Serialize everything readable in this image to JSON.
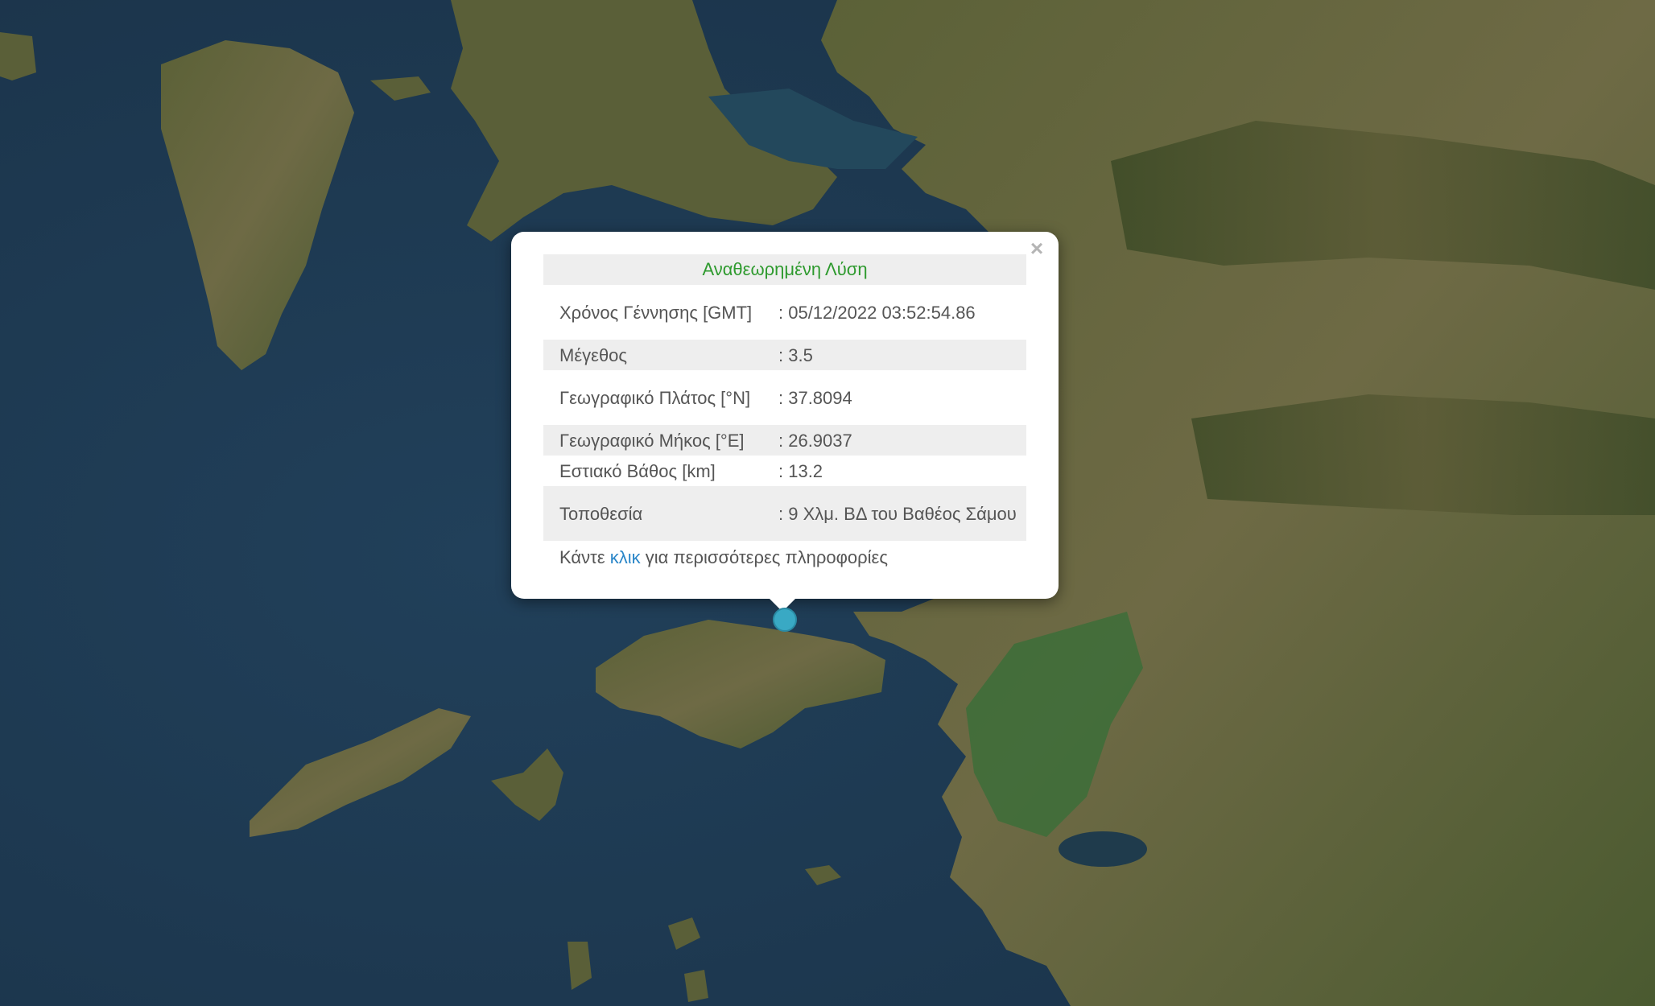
{
  "map": {
    "layer": "satellite",
    "colors": {
      "sea": "#1f3a52",
      "land": "#4f5a33",
      "land_dry": "#7a6d4f",
      "plain": "#3f6e3a"
    }
  },
  "marker": {
    "icon": "circle-marker-icon",
    "color": "#39a9c4"
  },
  "popup": {
    "close_label": "×",
    "title": "Αναθεωρημένη Λύση",
    "title_color": "#2e9a2e",
    "rows": [
      {
        "label": "Χρόνος Γέννησης [GMT]",
        "value": ": 05/12/2022 03:52:54.86"
      },
      {
        "label": "Μέγεθος",
        "value": ": 3.5"
      },
      {
        "label": "Γεωγραφικό Πλάτος [°N]",
        "value": ": 37.8094"
      },
      {
        "label": "Γεωγραφικό Μήκος [°E]",
        "value": ": 26.9037"
      },
      {
        "label": "Εστιακό Βάθος [km]",
        "value": ": 13.2"
      },
      {
        "label": "Τοποθεσία",
        "value": ": 9 Χλμ. ΒΔ του Βαθέος Σάμου"
      }
    ],
    "more_prefix": "Κάντε",
    "more_link": "κλικ",
    "more_suffix": "για περισσότερες πληροφορίες",
    "link_color": "#2a86c8"
  }
}
